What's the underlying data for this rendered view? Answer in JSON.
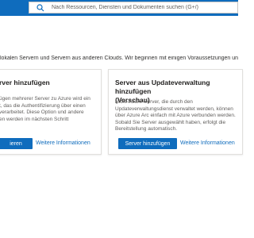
{
  "header": {
    "search_placeholder": "Nach Ressourcen, Diensten und Dokumenten suchen (G+/)"
  },
  "intro_text": "lokalen Servern und Servern aus anderen Clouds. Wir beginnen mit einigen Voraussetzungen und s",
  "cards": [
    {
      "title": "rver hinzufügen",
      "body_lines": [
        "ügen mehrerer Server zu Azure wird ein",
        "t, das die Authentifizierung über einen",
        "verarbeitet. Diese Option und andere",
        "en werden im nächsten Schritt"
      ],
      "button_label": "ieren",
      "link_label": "Weitere Informationen"
    },
    {
      "title_lines": [
        "Server aus Updateverwaltung hinzufügen",
        "(Vorschau)"
      ],
      "body_lines": [
        "Nicht-Azure-Server, die durch den",
        "Updateverwaltungsdienst verwaltet werden, können",
        "über Azure Arc einfach mit Azure verbunden werden.",
        "Sobald Sie Server ausgewählt haben, erfolgt die",
        "Bereitstellung automatisch."
      ],
      "button_label": "Server hinzufügen",
      "link_label": "Weitere Informationen"
    }
  ]
}
